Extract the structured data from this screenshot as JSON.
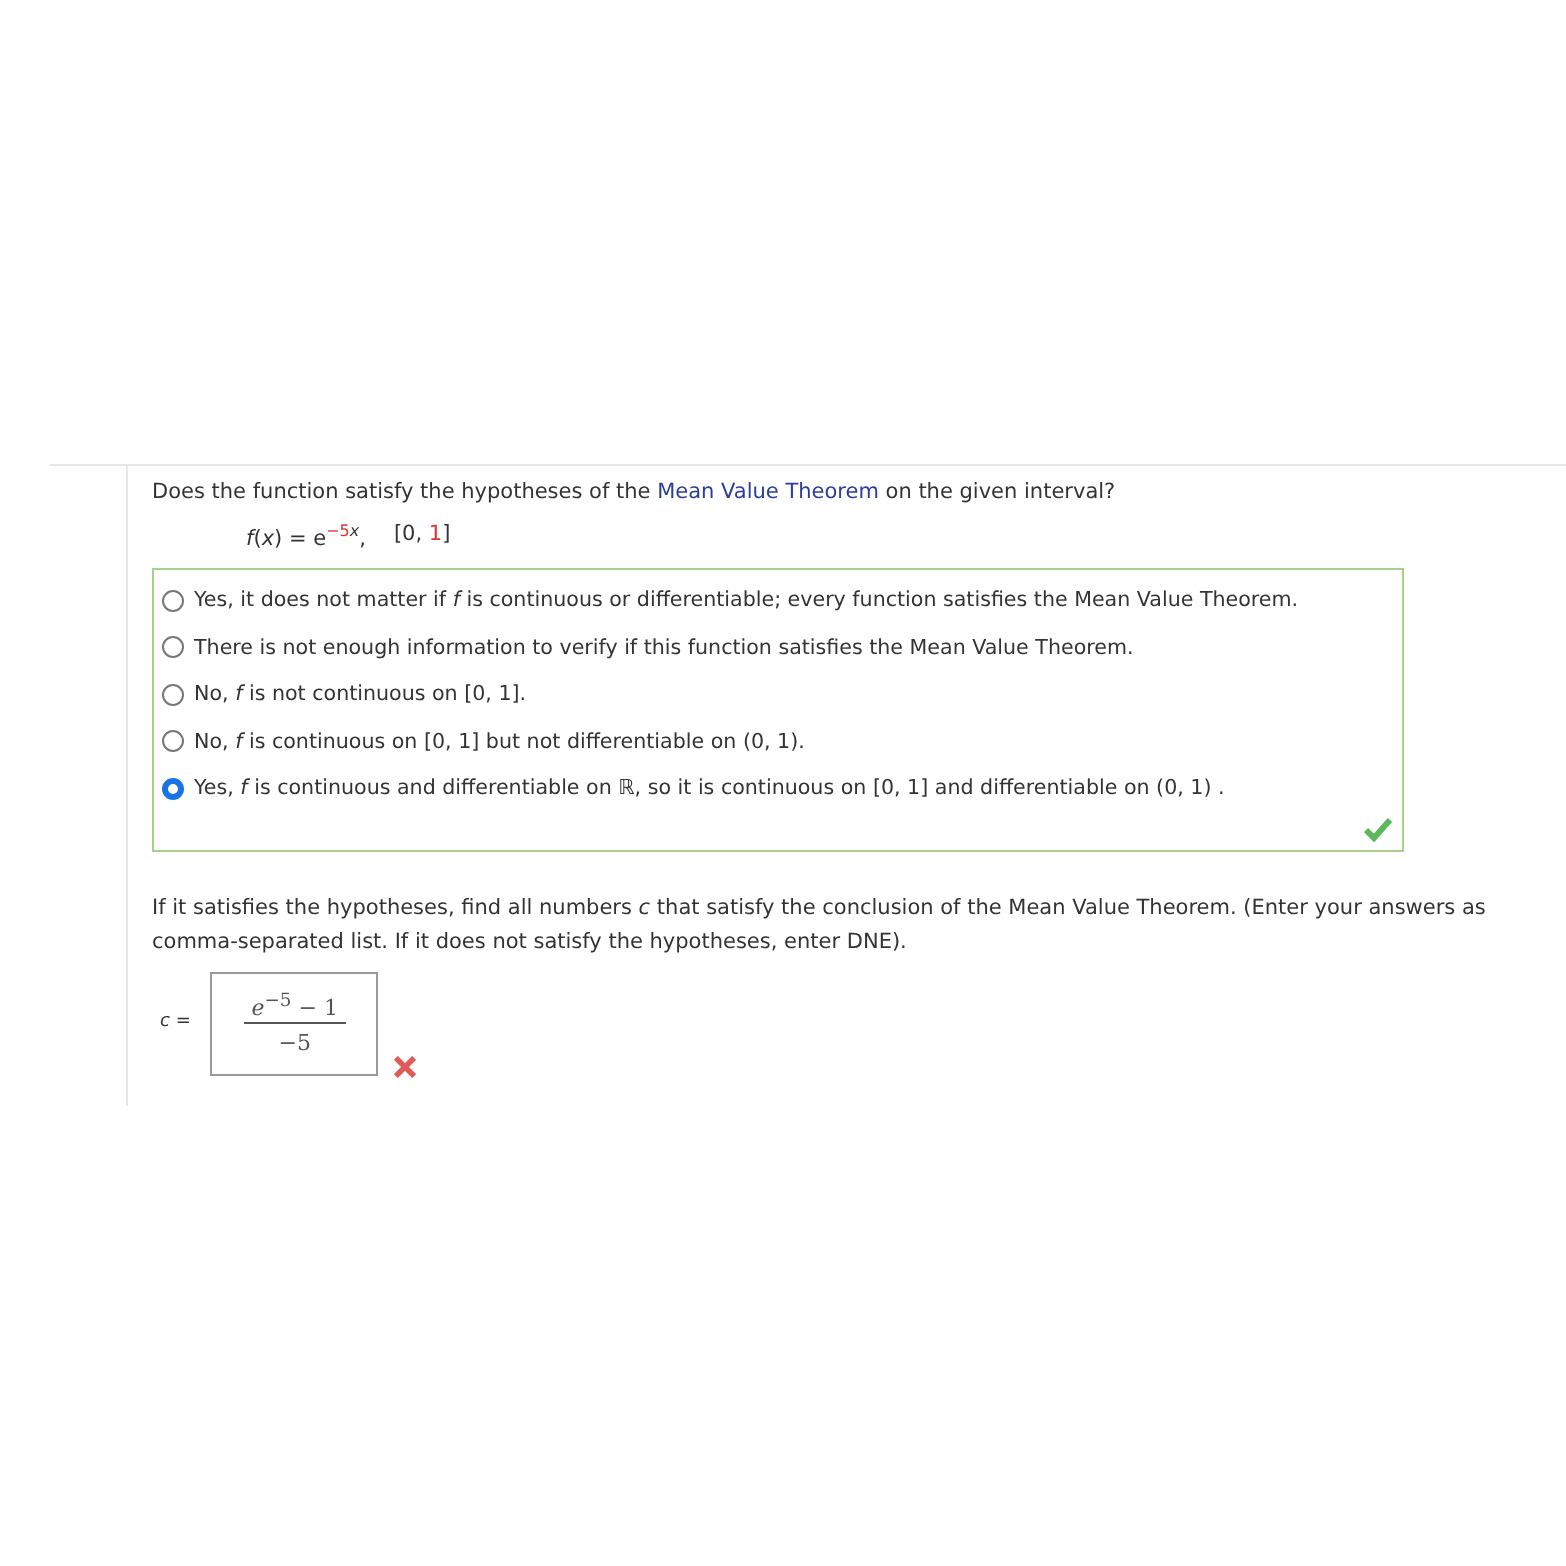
{
  "question": {
    "prompt_before": "Does the function satisfy the hypotheses of the",
    "link": "Mean Value Theorem",
    "prompt_after": "on the given interval?",
    "formula": {
      "lhs": "*f*(*x*) = e",
      "exponent_number": "−5",
      "exponent_var": "*x*",
      "separator": ",",
      "interval_open": "[0,",
      "interval_end": "1",
      "interval_close": "]"
    },
    "options": [
      {
        "text": "Yes, it does not matter if *f* is continuous or differentiable; every function satisfies the Mean Value Theorem.",
        "selected": false
      },
      {
        "text": "There is not enough information to verify if this function satisfies the Mean Value Theorem.",
        "selected": false
      },
      {
        "text": "No, *f* is not continuous on [0, 1].",
        "selected": false
      },
      {
        "text": "No, *f* is continuous on [0, 1] but not differentiable on (0, 1).",
        "selected": false
      },
      {
        "text": "Yes, *f* is continuous and differentiable on ℝ, so it is continuous on [0, 1] and differentiable on (0, 1) .",
        "selected": true
      }
    ],
    "options_correct": true
  },
  "part2": {
    "lines": [
      "If it satisfies the hypotheses, find all numbers *c* that satisfy the conclusion of the Mean Value Theorem. (Enter your answers as",
      "comma-separated list. If it does not satisfy the hypotheses, enter DNE)."
    ],
    "label": "*c* =",
    "numerator": "*e*$^{−5}$ − 1",
    "denominator": "−5",
    "correct": false
  }
}
